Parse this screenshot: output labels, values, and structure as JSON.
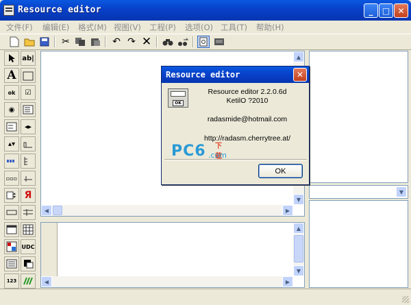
{
  "window": {
    "title": "Resource editor",
    "minimize": "_",
    "maximize": "□",
    "close": "✕"
  },
  "menu": [
    "文件(F)",
    "编辑(E)",
    "格式(M)",
    "视图(V)",
    "工程(P)",
    "选项(O)",
    "工具(T)",
    "帮助(H)"
  ],
  "palette": {
    "label_abl": "ab|",
    "label_A": "A",
    "label_ok": "ok",
    "label_udc": "UDC",
    "label_123": "123"
  },
  "dialog": {
    "title": "Resource editor",
    "close": "✕",
    "icon_label": "OK",
    "version": "Resource editor 2.2.0.6d",
    "copyright": "KetilO ?2010",
    "email": "radasmide@hotmail.com",
    "url": "http://radasm.cherrytree.at/",
    "ok_button": "OK"
  },
  "watermark": {
    "pc": "PC6",
    "download": "下载",
    "com": ".com"
  },
  "icons": [
    "new-file",
    "open-folder",
    "save",
    "cut",
    "copy",
    "paste",
    "undo",
    "redo",
    "delete",
    "find",
    "replace",
    "preview",
    "properties"
  ],
  "colors": {
    "titlebar": "#0840c8",
    "face": "#ece9d8",
    "close": "#c4401b"
  }
}
